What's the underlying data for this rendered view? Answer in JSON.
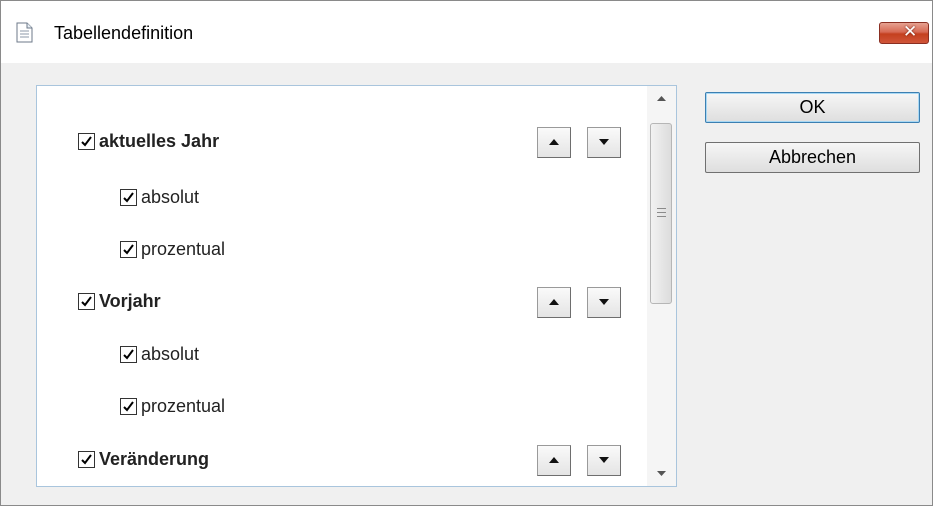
{
  "window": {
    "title": "Tabellendefinition",
    "close_glyph": "✕"
  },
  "list": {
    "groups": [
      {
        "label": "aktuelles Jahr",
        "checked": true,
        "children": [
          {
            "label": "absolut",
            "checked": true
          },
          {
            "label": "prozentual",
            "checked": true
          }
        ]
      },
      {
        "label": "Vorjahr",
        "checked": true,
        "children": [
          {
            "label": "absolut",
            "checked": true
          },
          {
            "label": "prozentual",
            "checked": true
          }
        ]
      },
      {
        "label": "Veränderung",
        "checked": true,
        "children": []
      }
    ]
  },
  "buttons": {
    "ok": "OK",
    "cancel": "Abbrechen"
  }
}
